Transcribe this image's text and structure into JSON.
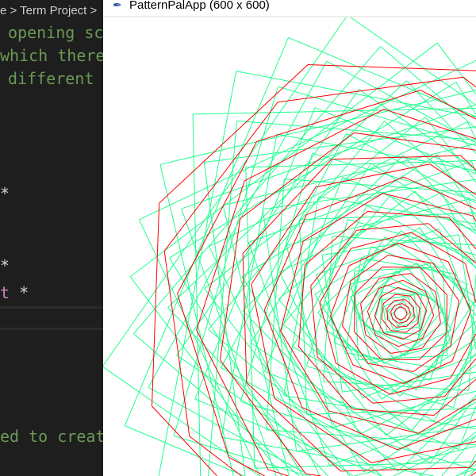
{
  "editor": {
    "breadcrumb": "e > Term Project >",
    "lines": [
      "opening sc",
      "which there",
      "different",
      "*",
      "*",
      "*",
      "ed to creat"
    ],
    "keyword_fragment": "t"
  },
  "app": {
    "title": "PatternPalApp (600 x 600)",
    "icon": "feather-icon",
    "colors": {
      "square": "#1eff8c",
      "polygon": "#ff0000",
      "background": "#ffffff"
    }
  }
}
